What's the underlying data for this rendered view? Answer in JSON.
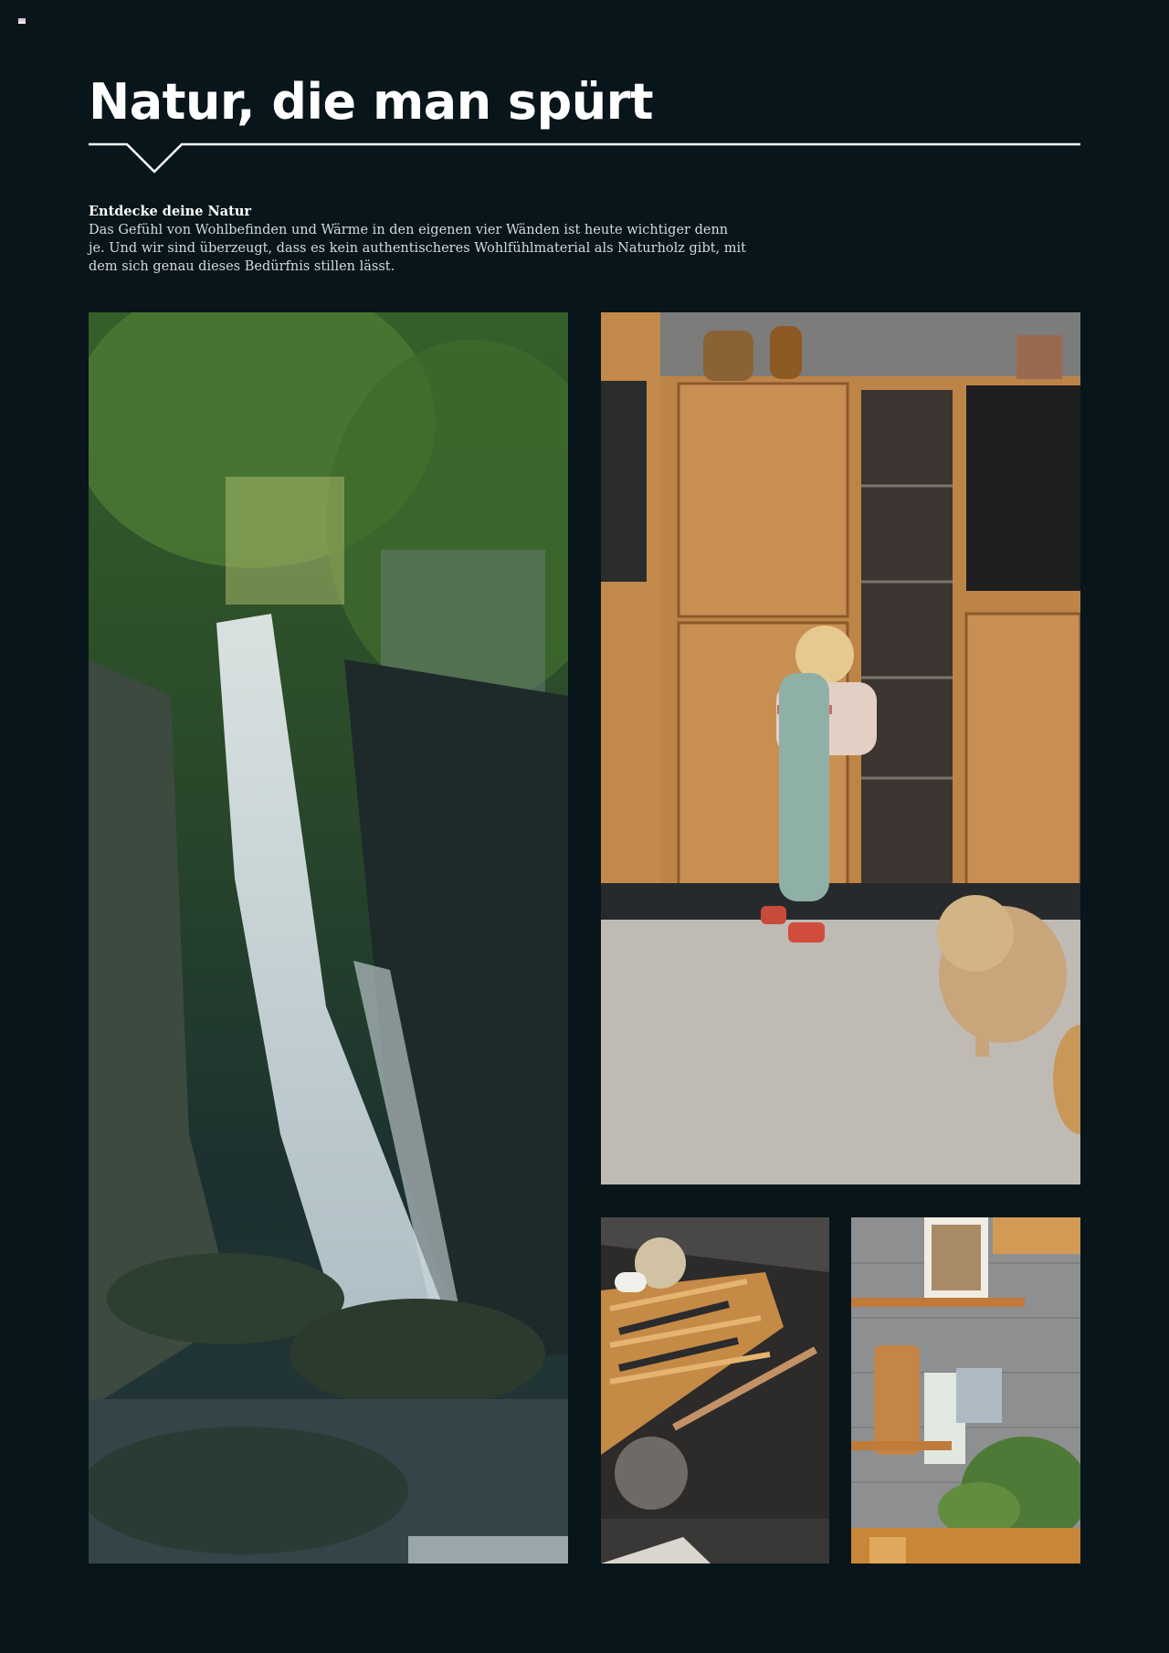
{
  "page": {
    "title": "Natur, die man spürt",
    "intro_heading": "Entdecke deine Natur",
    "intro_text": "Das Gefühl von Wohlbefinden und Wärme in den eigenen vier Wänden ist heute wichtiger denn je. Und wir sind überzeugt, dass es kein authentischeres Wohlfühlmaterial als Naturholz gibt, mit dem sich genau dieses Bedürfnis stillen lässt."
  },
  "colors": {
    "background": "#08151a",
    "title": "#ffffff",
    "body_text": "#d5dadb",
    "rule": "#ffffff"
  },
  "images": [
    {
      "name": "waterfall-photo",
      "icon": "waterfall-image"
    },
    {
      "name": "kitchen-child-dog-photo",
      "icon": "kitchen-image"
    },
    {
      "name": "drawer-knives-photo",
      "icon": "drawer-image"
    },
    {
      "name": "wall-shelf-photo",
      "icon": "shelf-image"
    }
  ]
}
